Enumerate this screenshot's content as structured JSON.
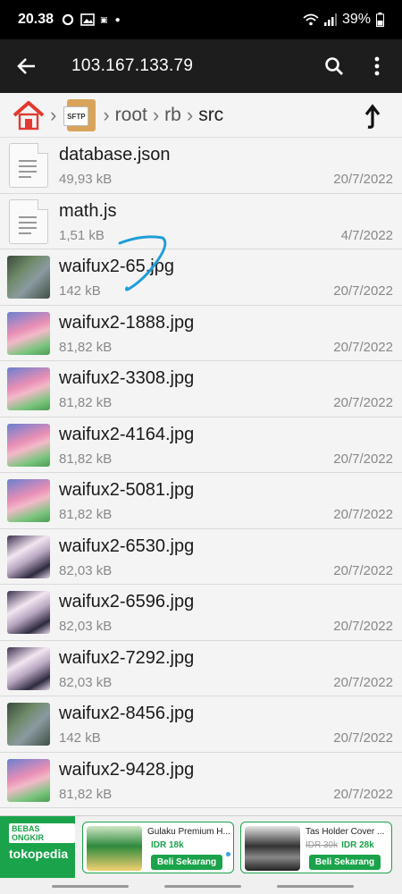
{
  "status": {
    "time": "20.38",
    "battery": "39%"
  },
  "appbar": {
    "title": "103.167.133.79"
  },
  "breadcrumb": {
    "badge": "SFTP",
    "items": [
      "root",
      "rb",
      "src"
    ]
  },
  "files": [
    {
      "name": "database.json",
      "size": "49,93 kB",
      "date": "20/7/2022",
      "kind": "doc"
    },
    {
      "name": "math.js",
      "size": "1,51 kB",
      "date": "4/7/2022",
      "kind": "doc"
    },
    {
      "name": "waifux2-65.jpg",
      "size": "142 kB",
      "date": "20/7/2022",
      "kind": "img-a"
    },
    {
      "name": "waifux2-1888.jpg",
      "size": "81,82 kB",
      "date": "20/7/2022",
      "kind": "img-b"
    },
    {
      "name": "waifux2-3308.jpg",
      "size": "81,82 kB",
      "date": "20/7/2022",
      "kind": "img-b"
    },
    {
      "name": "waifux2-4164.jpg",
      "size": "81,82 kB",
      "date": "20/7/2022",
      "kind": "img-b"
    },
    {
      "name": "waifux2-5081.jpg",
      "size": "81,82 kB",
      "date": "20/7/2022",
      "kind": "img-b"
    },
    {
      "name": "waifux2-6530.jpg",
      "size": "82,03 kB",
      "date": "20/7/2022",
      "kind": "img-c"
    },
    {
      "name": "waifux2-6596.jpg",
      "size": "82,03 kB",
      "date": "20/7/2022",
      "kind": "img-c"
    },
    {
      "name": "waifux2-7292.jpg",
      "size": "82,03 kB",
      "date": "20/7/2022",
      "kind": "img-c"
    },
    {
      "name": "waifux2-8456.jpg",
      "size": "142 kB",
      "date": "20/7/2022",
      "kind": "img-a"
    },
    {
      "name": "waifux2-9428.jpg",
      "size": "81,82 kB",
      "date": "20/7/2022",
      "kind": "img-b"
    }
  ],
  "ad": {
    "brand": "tokopedia",
    "tag": "BEBAS ONGKIR",
    "cards": [
      {
        "title": "Gulaku Premium H...",
        "old_price": "",
        "price": "IDR 18k",
        "cta": "Beli Sekarang"
      },
      {
        "title": "Tas Holder Cover ...",
        "old_price": "IDR 30k",
        "price": "IDR 28k",
        "cta": "Beli Sekarang"
      }
    ]
  }
}
